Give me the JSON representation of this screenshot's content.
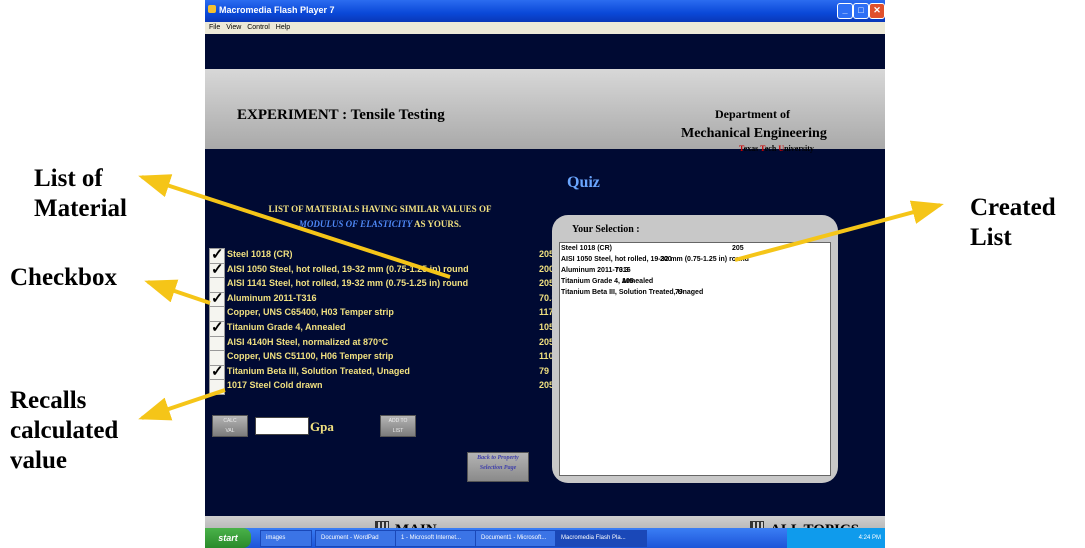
{
  "annotations": {
    "list_of_material": "List of\nMaterial",
    "checkbox": "Checkbox",
    "recalls": "Recalls\ncalculated\nvalue",
    "created_list": "Created\nList"
  },
  "window": {
    "title": "Macromedia Flash Player 7",
    "menu": [
      "File",
      "View",
      "Control",
      "Help"
    ]
  },
  "header": {
    "experiment": "EXPERIMENT : Tensile Testing",
    "dept_line1": "Department of",
    "dept_line2": "Mechanical Engineering",
    "dept_line3_parts": [
      "T",
      "exas ",
      "T",
      "ech ",
      "U",
      "niversity"
    ]
  },
  "quiz_title": "Quiz",
  "list": {
    "heading_line1": "LIST OF MATERIALS HAVING SIMILAR VALUES OF",
    "heading_em": "MODULUS OF ELASTICITY",
    "heading_tail": " AS YOURS.",
    "materials": [
      {
        "name": "Steel 1018 (CR)",
        "value": "205",
        "checked": true
      },
      {
        "name": "AISI 1050 Steel, hot rolled, 19-32 mm (0.75-1.25 in) round",
        "value": "200",
        "checked": true
      },
      {
        "name": "AISI 1141 Steel, hot rolled, 19-32 mm (0.75-1.25 in) round",
        "value": "205",
        "checked": false
      },
      {
        "name": "Aluminum 2011-T316",
        "value": "70.3",
        "checked": true
      },
      {
        "name": "Copper, UNS C65400, H03 Temper strip",
        "value": "117",
        "checked": false
      },
      {
        "name": "Titanium Grade 4, Annealed",
        "value": "105",
        "checked": true
      },
      {
        "name": "AISI 4140H Steel, normalized at 870°C",
        "value": "205",
        "checked": false
      },
      {
        "name": "Copper, UNS C51100, H06 Temper strip",
        "value": "110",
        "checked": false
      },
      {
        "name": "Titanium Beta III, Solution Treated, Unaged",
        "value": "79",
        "checked": true
      },
      {
        "name": "1017 Steel Cold drawn",
        "value": "205",
        "checked": false
      }
    ]
  },
  "controls": {
    "recall_btn": "CALC\nVAL",
    "gpa_value": "",
    "gpa_label": "Gpa",
    "add_btn": "ADD TO\nLIST",
    "back_btn": "Back to Property\nSelection Page"
  },
  "selection": {
    "title": "Your Selection :",
    "items": [
      {
        "name": "Steel 1018 (CR)",
        "value": "205"
      },
      {
        "name": "AISI 1050 Steel, hot rolled, 19-32 mm (0.75-1.25 in) round",
        "value": "200"
      },
      {
        "name": "Aluminum 2011-T316",
        "value": "70.3"
      },
      {
        "name": "Titanium Grade 4, Annealed",
        "value": "105"
      },
      {
        "name": "Titanium Beta III, Solution Treated, Unaged",
        "value": "79"
      }
    ]
  },
  "nav": {
    "main": "MAIN",
    "all_topics": "ALL TOPICS"
  },
  "taskbar": {
    "start": "start",
    "tasks": [
      "images",
      "Document - WordPad",
      "1 - Microsoft Internet...",
      "Document1 - Microsoft...",
      "Macromedia Flash Pla..."
    ],
    "clock": "4:24 PM"
  },
  "colors": {
    "flash_bg": "#000a33",
    "list_text": "#f0e080",
    "quiz_title": "#6aa6ff",
    "arrow": "#f5c518"
  }
}
